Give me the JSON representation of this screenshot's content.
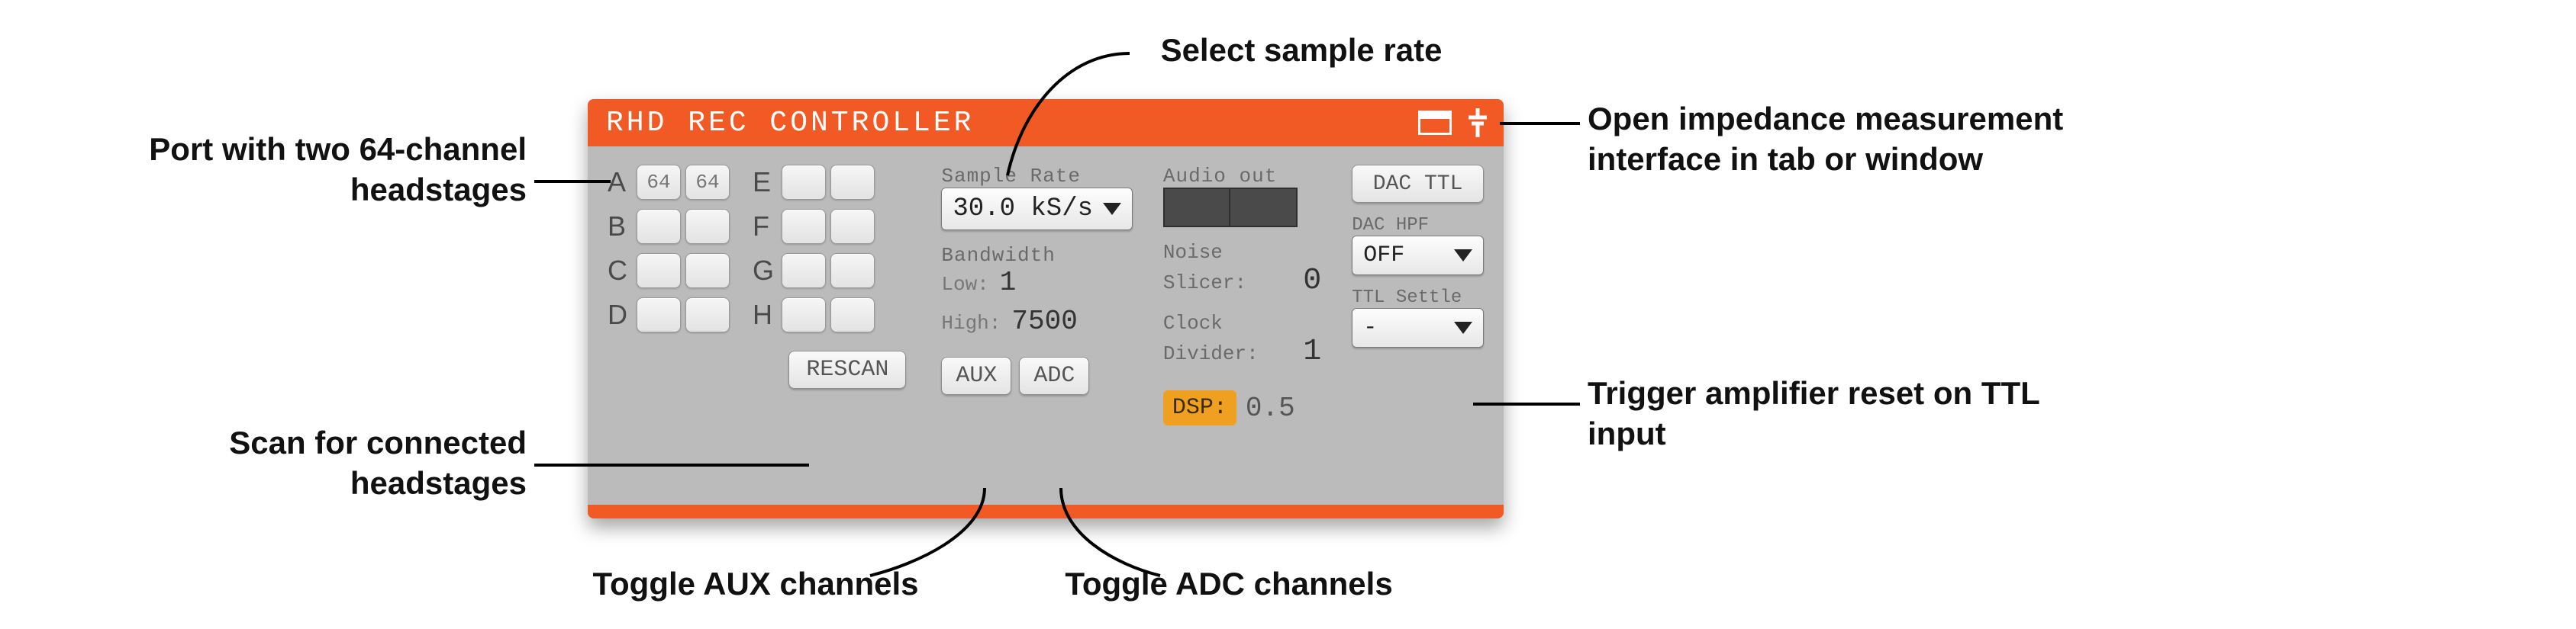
{
  "title": "RHD REC CONTROLLER",
  "ports": {
    "left": [
      "A",
      "B",
      "C",
      "D"
    ],
    "right": [
      "E",
      "F",
      "G",
      "H"
    ],
    "slots": {
      "A": [
        "64",
        "64"
      ],
      "B": [
        "",
        ""
      ],
      "C": [
        "",
        ""
      ],
      "D": [
        "",
        ""
      ],
      "E": [
        "",
        ""
      ],
      "F": [
        "",
        ""
      ],
      "G": [
        "",
        ""
      ],
      "H": [
        "",
        ""
      ]
    },
    "rescan": "RESCAN"
  },
  "sample_rate": {
    "label": "Sample Rate",
    "value": "30.0 kS/s"
  },
  "bandwidth": {
    "label": "Bandwidth",
    "low_key": "Low:",
    "low_val": "1",
    "high_key": "High:",
    "high_val": "7500"
  },
  "toggles": {
    "aux": "AUX",
    "adc": "ADC"
  },
  "audio_out": {
    "label": "Audio out"
  },
  "noise": {
    "key1": "Noise",
    "key2": "Slicer:",
    "val": "0"
  },
  "clock": {
    "key1": "Clock",
    "key2": "Divider:",
    "val": "1"
  },
  "dsp": {
    "badge": "DSP:",
    "val": "0.5"
  },
  "dac_ttl": "DAC TTL",
  "dac_hpf": {
    "label": "DAC HPF",
    "value": "OFF"
  },
  "ttl_settle": {
    "label": "TTL Settle",
    "value": "-"
  },
  "callouts": {
    "sample_rate": "Select sample rate",
    "port_a": "Port with two 64-channel headstages",
    "rescan": "Scan for connected headstages",
    "aux": "Toggle AUX channels",
    "adc": "Toggle ADC channels",
    "impedance": "Open impedance measurement interface in tab or window",
    "ttl": "Trigger amplifier reset on TTL input"
  }
}
